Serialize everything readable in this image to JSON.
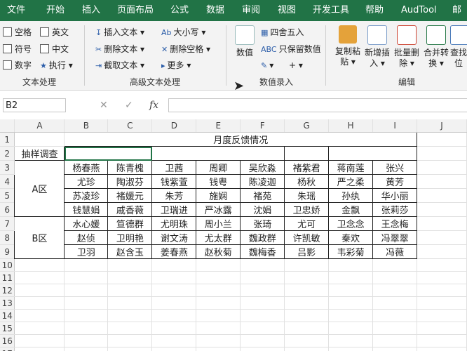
{
  "tabs": [
    "文件",
    "开始",
    "插入",
    "页面布局",
    "公式",
    "数据",
    "审阅",
    "视图",
    "开发工具",
    "帮助",
    "AudTool",
    "邮"
  ],
  "ribbon": {
    "text_process": {
      "checks": [
        "空格",
        "英文",
        "符号",
        "中文",
        "数字"
      ],
      "exec_label": "执行",
      "group_label": "文本处理"
    },
    "adv_text": {
      "items": [
        "插入文本",
        "删除文本",
        "截取文本",
        "大小写",
        "删除空格",
        "更多"
      ],
      "group_label": "高级文本处理"
    },
    "number_entry": {
      "value_label": "数值",
      "round_label": "四舍五入",
      "keep_value_label": "只保留数值",
      "group_label": "数值录入"
    },
    "edit": {
      "buttons": [
        {
          "line1": "复制粘",
          "line2": "贴"
        },
        {
          "line1": "新增插",
          "line2": "入"
        },
        {
          "line1": "批量删",
          "line2": "除"
        },
        {
          "line1": "合并转",
          "line2": "换"
        },
        {
          "line1": "查找",
          "line2": "位"
        }
      ],
      "group_label": "编辑"
    }
  },
  "formula_bar": {
    "name_box": "B2",
    "fx": "fx",
    "cancel": "✕",
    "confirm": "✓"
  },
  "columns": [
    "A",
    "B",
    "C",
    "D",
    "E",
    "F",
    "G",
    "H",
    "I",
    "J"
  ],
  "rows": [
    "1",
    "2",
    "3",
    "4",
    "5",
    "6",
    "7",
    "8",
    "9",
    "10",
    "11",
    "12",
    "13",
    "14",
    "15",
    "16",
    "17"
  ],
  "sheet": {
    "title": "月度反馈情况",
    "a2": "抽样调查",
    "zone_a": "A区",
    "zone_b": "B区",
    "names": [
      [
        "杨春燕",
        "陈青槐",
        "卫茜",
        "周卿",
        "吴欣淼",
        "褚紫君",
        "蒋南莲",
        "张兴"
      ],
      [
        "尤珍",
        "陶淑芬",
        "钱紫萱",
        "钱粤",
        "陈凌迦",
        "杨秋",
        "严之柔",
        "黄芳"
      ],
      [
        "苏凌珍",
        "褚媛元",
        "朱芳",
        "施娴",
        "褚苑",
        "朱瑶",
        "孙纨",
        "华小丽"
      ],
      [
        "钱慧娟",
        "戚香薇",
        "卫瑞进",
        "严冰露",
        "沈娟",
        "卫忠娇",
        "金飘",
        "张莉莎"
      ],
      [
        "水心媛",
        "笪德群",
        "尤明珠",
        "周小兰",
        "张琦",
        "尤可",
        "卫念念",
        "王念梅"
      ],
      [
        "赵侦",
        "卫明艳",
        "谢文涛",
        "尤太群",
        "魏政群",
        "许凯敏",
        "秦欢",
        "冯翠翠"
      ],
      [
        "卫羽",
        "赵含玉",
        "姜春燕",
        "赵秋菊",
        "魏梅香",
        "吕影",
        "韦彩菊",
        "冯薇"
      ]
    ]
  }
}
